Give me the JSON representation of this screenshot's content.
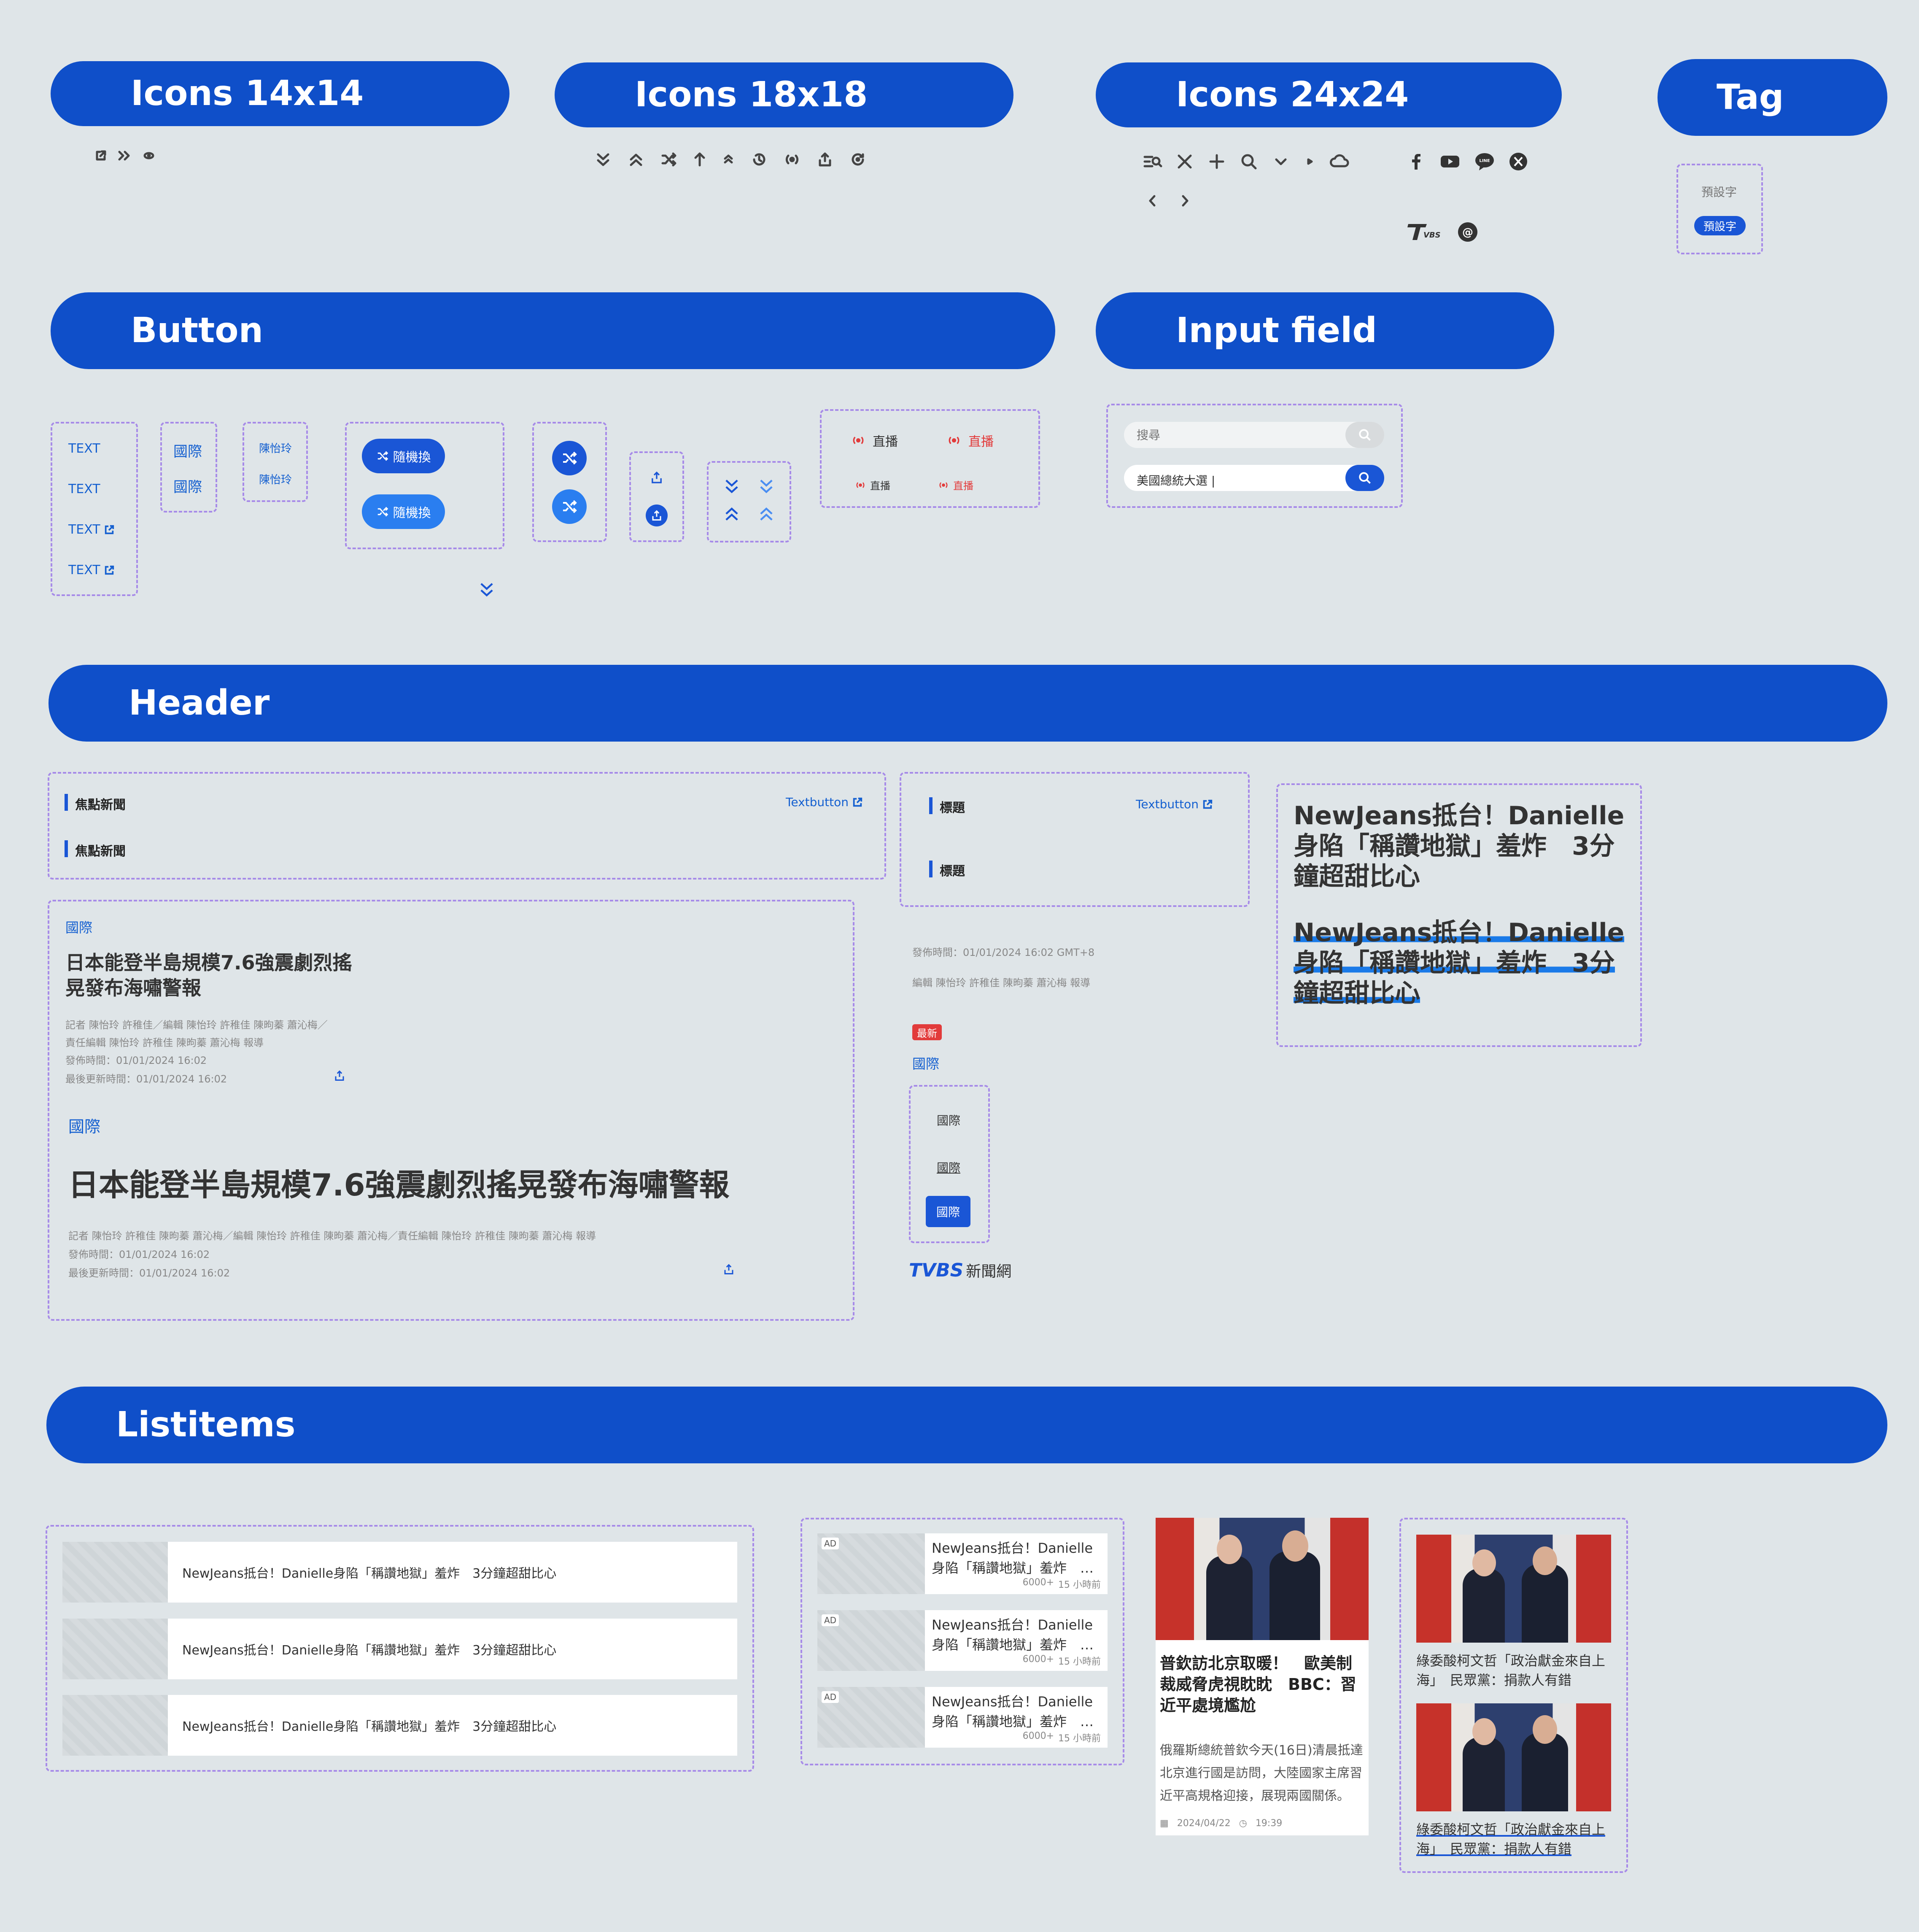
{
  "sections": {
    "icons14": "Icons 14x14",
    "icons18": "Icons 18x18",
    "icons24": "Icons 24x24",
    "tag": "Tag",
    "button": "Button",
    "input": "Input field",
    "header": "Header",
    "listitems": "Listitems"
  },
  "icons": {
    "size14": [
      "external-link-icon",
      "double-chevron-right-icon",
      "dot-icon"
    ],
    "size18": [
      "double-chevron-down-icon",
      "double-chevron-up-icon",
      "shuffle-icon",
      "arrow-up-icon",
      "chevron-up-small-icon",
      "history-icon",
      "live-icon",
      "share-icon",
      "refresh-icon"
    ],
    "size24": [
      "menu-search-icon",
      "close-icon",
      "plus-icon",
      "search-icon",
      "chevron-down-icon",
      "play-small-icon",
      "cloud-icon",
      "chevron-left-icon",
      "chevron-right-icon"
    ],
    "social": [
      "facebook-icon",
      "youtube-icon",
      "line-icon",
      "x-icon",
      "tvbs-logo-icon",
      "threads-icon"
    ]
  },
  "tag": {
    "default": "預設字",
    "active": "預設字"
  },
  "buttons": {
    "text": "TEXT",
    "category": "國際",
    "author": "陳怡玲",
    "random": "隨機換",
    "live": "直播"
  },
  "input": {
    "placeholder": "搜尋",
    "value": "美國總統大選 |"
  },
  "header": {
    "focus_news": "焦點新聞",
    "textbutton": "Textbutton",
    "title": "標題",
    "headline": "NewJeans抵台！Danielle身陷「稱讚地獄」羞炸　3分鐘超甜比心",
    "category": "國際",
    "article_title_small": "日本能登半島規模7.6強震劇烈搖晃發布海嘯警報",
    "article_title_large": "日本能登半島規模7.6強震劇烈搖晃發布海嘯警報",
    "byline_small_1": "記者 陳怡玲 許稚佳／編輯 陳怡玲 許稚佳 陳昫蓁 蕭沁梅／",
    "byline_small_2": "責任編輯 陳怡玲 許稚佳 陳昫蓁 蕭沁梅 報導",
    "publish_small": "發佈時間：01/01/2024 16:02",
    "update_small": "最後更新時間：01/01/2024 16:02",
    "byline_large": "記者 陳怡玲 許稚佳 陳昫蓁 蕭沁梅／編輯 陳怡玲 許稚佳 陳昫蓁 蕭沁梅／責任編輯 陳怡玲 許稚佳 陳昫蓁 蕭沁梅 報導",
    "publish_large": "發佈時間：01/01/2024 16:02",
    "update_large": "最後更新時間：01/01/2024 16:02",
    "publish_gmt": "發佈時間：01/01/2024 16:02 GMT+8",
    "editor_line": "編輯 陳怡玲 許稚佳 陳昫蓁 蕭沁梅 報導",
    "newest": "最新",
    "logo_text": "TVBS",
    "logo_sub": "新聞網"
  },
  "listitems": {
    "headline": "NewJeans抵台！Danielle身陷「稱讚地獄」羞炸　3分鐘超甜比心",
    "ad": "AD",
    "views": "6000+",
    "time": "15 小時前",
    "card_title": "普欽訪北京取暖！　歐美制裁威脅虎視眈眈　BBC：習近平處境尷尬",
    "card_desc": "俄羅斯總統普欽今天(16日)清晨抵達北京進行國是訪問，大陸國家主席習近平高規格迎接，展現兩國關係。",
    "card_date": "2024/04/22",
    "card_time": "19:39",
    "small_card_title": "綠委酸柯文哲「政治獻金來自上海」　民眾黨：捐款人有錯"
  }
}
